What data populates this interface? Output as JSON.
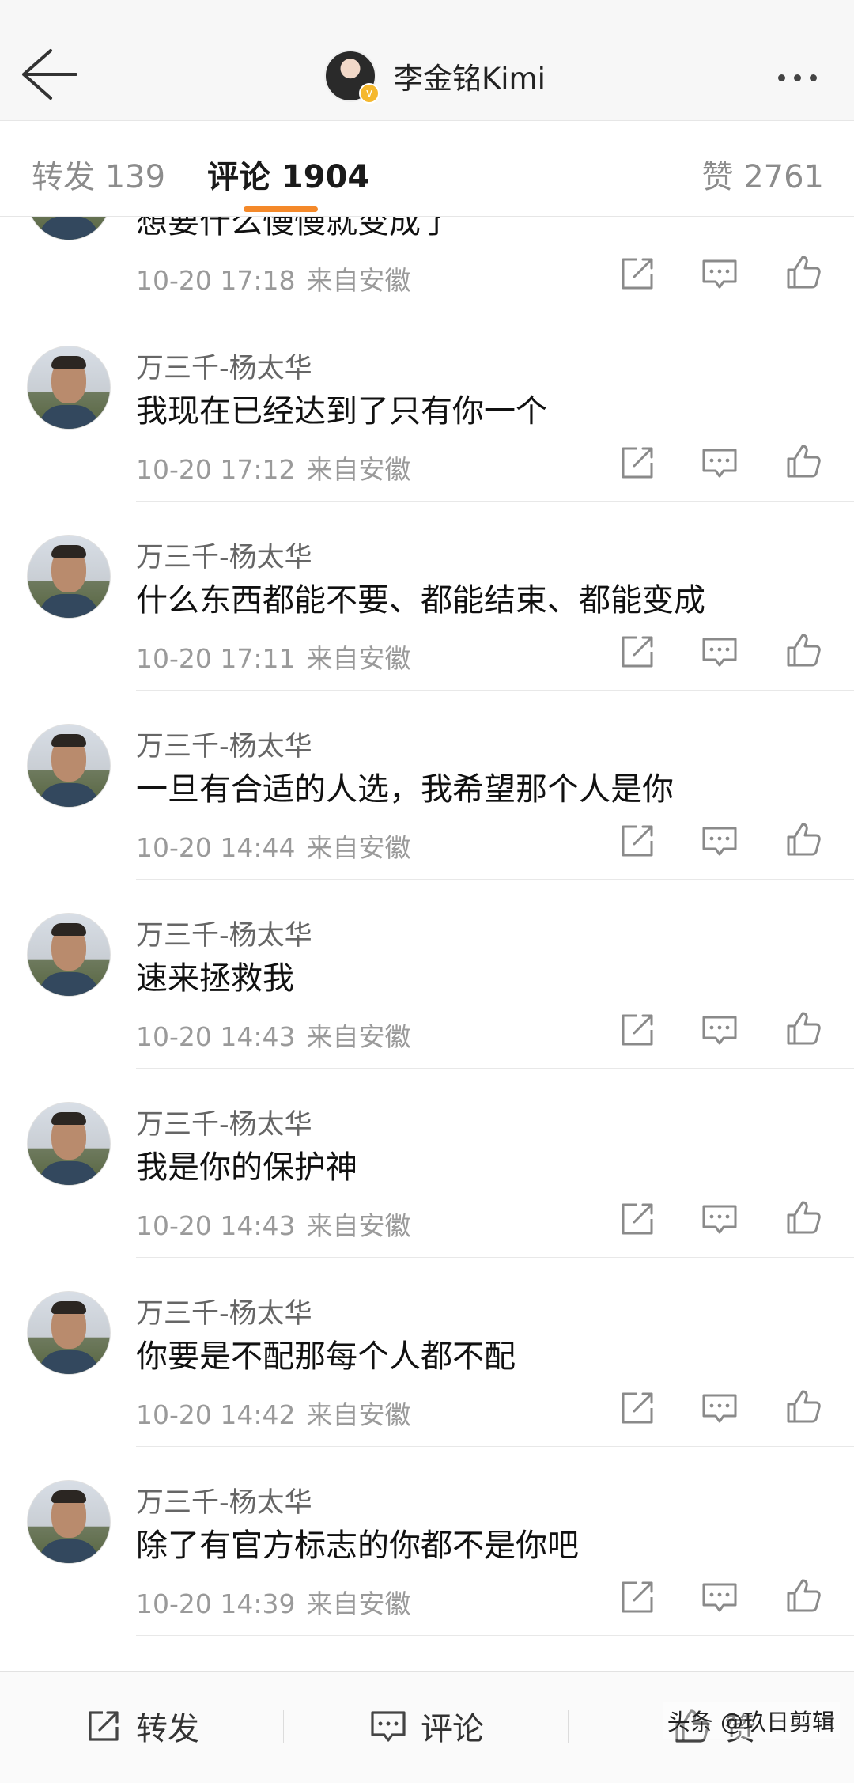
{
  "header": {
    "title": "李金铭Kimi",
    "back_icon": "arrow-left-icon",
    "more_icon": "more-dots-icon",
    "verified_mark": "v"
  },
  "tabs": {
    "repost": "转发 139",
    "comments": "评论 1904",
    "likes": "赞 2761",
    "accent_color": "#f4892a"
  },
  "comments": [
    {
      "user": "",
      "text": "想要什么慢慢就变成了",
      "time": "10-20 17:18",
      "source": "来自安徽"
    },
    {
      "user": "万三千-杨太华",
      "text": "我现在已经达到了只有你一个",
      "time": "10-20 17:12",
      "source": "来自安徽"
    },
    {
      "user": "万三千-杨太华",
      "text": "什么东西都能不要、都能结束、都能变成",
      "time": "10-20 17:11",
      "source": "来自安徽"
    },
    {
      "user": "万三千-杨太华",
      "text": "一旦有合适的人选，我希望那个人是你",
      "time": "10-20 14:44",
      "source": "来自安徽"
    },
    {
      "user": "万三千-杨太华",
      "text": "速来拯救我",
      "time": "10-20 14:43",
      "source": "来自安徽"
    },
    {
      "user": "万三千-杨太华",
      "text": "我是你的保护神",
      "time": "10-20 14:43",
      "source": "来自安徽"
    },
    {
      "user": "万三千-杨太华",
      "text": "你要是不配那每个人都不配",
      "time": "10-20 14:42",
      "source": "来自安徽"
    },
    {
      "user": "万三千-杨太华",
      "text": "除了有官方标志的你都不是你吧",
      "time": "10-20 14:39",
      "source": "来自安徽"
    }
  ],
  "bottom_bar": {
    "repost": "转发",
    "comment": "评论",
    "like": "赞"
  },
  "watermark": "头条 @玖日剪辑"
}
